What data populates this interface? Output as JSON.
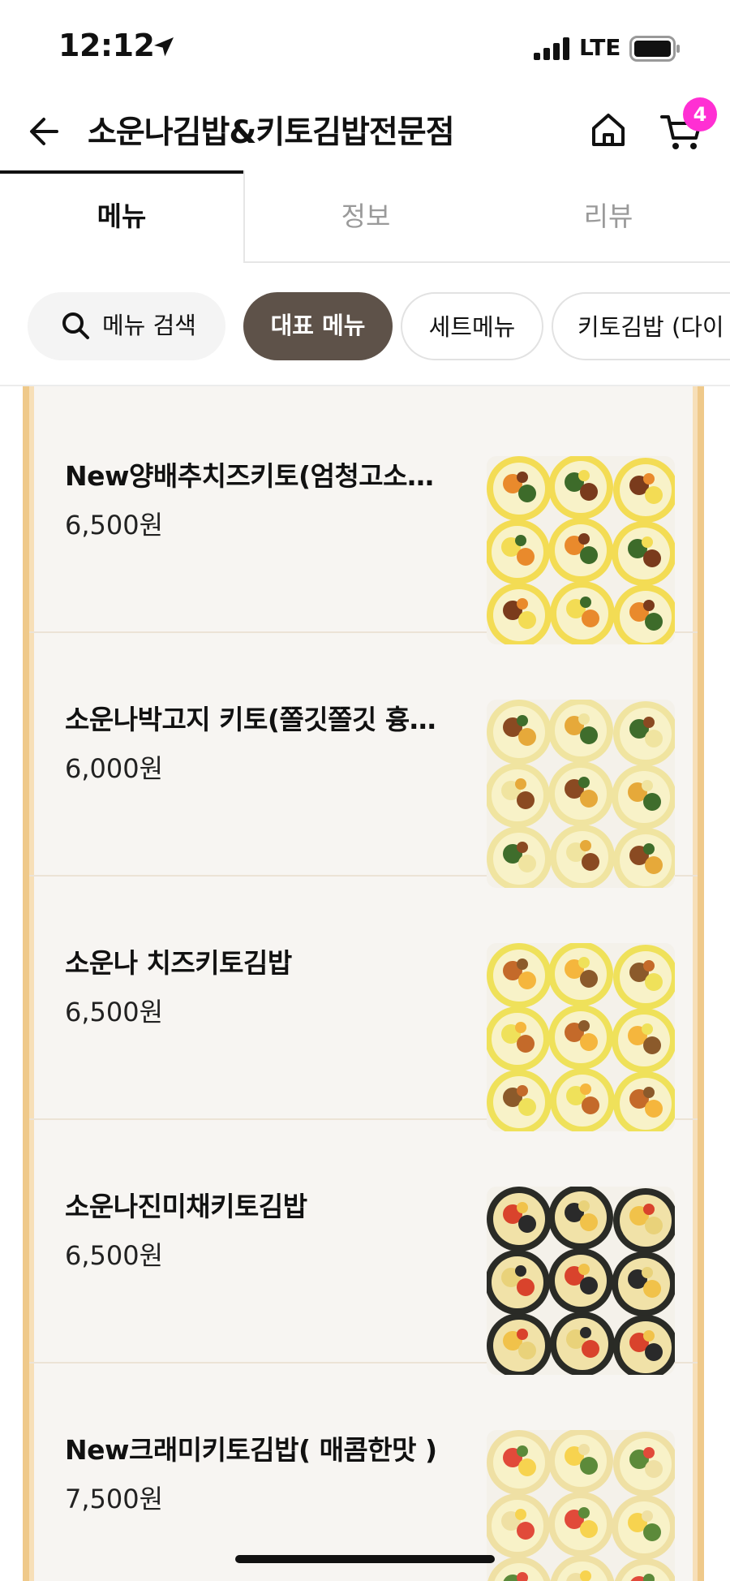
{
  "status_bar": {
    "time": "12:12",
    "network": "LTE"
  },
  "header": {
    "store_name": "소운나김밥&키토김밥전문점",
    "cart_count": "4"
  },
  "tabs": [
    {
      "label": "메뉴",
      "active": true
    },
    {
      "label": "정보",
      "active": false
    },
    {
      "label": "리뷰",
      "active": false
    }
  ],
  "chips": {
    "search_label": "메뉴 검색",
    "items": [
      {
        "label": "대표 메뉴",
        "active": true
      },
      {
        "label": "세트메뉴",
        "active": false
      },
      {
        "label": "키토김밥 (다이",
        "active": false
      }
    ]
  },
  "menu_items": [
    {
      "name": "New양배추치즈키토(엄청고소…",
      "price": "6,500원",
      "image": "kimbap-photo"
    },
    {
      "name": "소운나박고지 키토(쫄깃쫄깃 흉…",
      "price": "6,000원",
      "image": "kimbap-photo"
    },
    {
      "name": "소운나 치즈키토김밥",
      "price": "6,500원",
      "image": "kimbap-photo"
    },
    {
      "name": "소운나진미채키토김밥",
      "price": "6,500원",
      "image": "kimbap-photo"
    },
    {
      "name": "New크래미키토김밥( 매콤한맛 )",
      "price": "7,500원",
      "image": "kimbap-photo"
    }
  ],
  "colors": {
    "active_chip": "#5e5249",
    "frame_border": "#efc98a",
    "badge": "#ff2fd3"
  }
}
